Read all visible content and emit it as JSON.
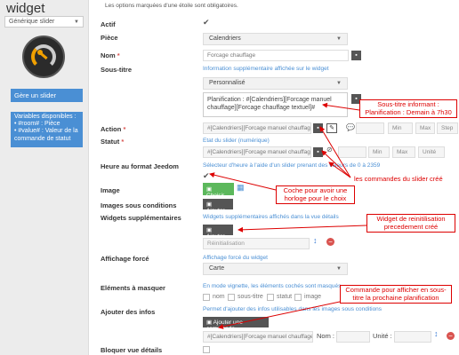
{
  "window": {
    "title": "widget"
  },
  "sidebar": {
    "type_select": "Générique slider",
    "manage_button": "Gère un slider",
    "variables_title": "Variables disponibles :",
    "variables": [
      "#room# : Pièce",
      "#value# : Valeur de la commande de statut"
    ]
  },
  "form": {
    "required_note": "Les options marquées d'une étoile sont obligatoires.",
    "actif": {
      "label": "Actif"
    },
    "piece": {
      "label": "Pièce",
      "value": "Calendriers"
    },
    "nom": {
      "label": "Nom",
      "value": "Forcage chauffage"
    },
    "sous_titre": {
      "label": "Sous-titre",
      "hint": "Information supplémentaire affichée sur le widget",
      "select": "Personnalisé",
      "text": "Planification : #[Calendriers][Forcage manuel chauffage][Forcage chauffage textuel]#"
    },
    "action": {
      "label": "Action",
      "value": "#[Calendriers][Forcage manuel chauffage][",
      "min": "Min",
      "max": "Max",
      "step": "Step"
    },
    "statut": {
      "label": "Statut",
      "hint": "Etat du slider (numérique)",
      "value": "#[Calendriers][Forcage manuel chauffage][",
      "min": "Min",
      "max": "Max",
      "unite": "Unité"
    },
    "heure": {
      "label": "Heure au format Jeedom",
      "hint": "Sélecteur d'heure à l'aide d'un slider prenant des valeurs de 0 à 2359"
    },
    "image": {
      "label": "Image",
      "button": "Choisir"
    },
    "images_conditions": {
      "label": "Images sous conditions",
      "button": "Ajouter"
    },
    "widgets_supp": {
      "label": "Widgets supplémentaires",
      "hint": "Widgets supplémentaires affichés dans la vue détails",
      "button": "Ajouter",
      "item": "Réinitialisation"
    },
    "affichage_force": {
      "label": "Affichage forcé",
      "hint": "Affichage forcé du widget",
      "value": "Carte"
    },
    "elements_masquer": {
      "label": "Eléments à masquer",
      "hint": "En mode vignette, les éléments cochés sont masqués",
      "options": [
        "nom",
        "sous-titre",
        "statut",
        "image"
      ]
    },
    "ajouter_infos": {
      "label": "Ajouter des infos",
      "hint": "Permet d'ajouter des infos utilisables dans les images sous conditions",
      "button": "Ajouter une commande",
      "value": "#[Calendriers][Forcage manuel chauffage][F",
      "nom_label": "Nom :",
      "unite_label": "Unité :"
    },
    "bloquer": {
      "label": "Bloquer vue détails"
    }
  },
  "annotations": [
    "Sous-titre informant : Planification : Demain à 7h30",
    "les commandes du slider créé",
    "Coche pour avoir une horloge pour le choix",
    "Widget de reinitilisation precedement créé",
    "Commande pour afficher en sous-titre la prochaine planification"
  ],
  "colors": {
    "accent": "#4a8fd4",
    "annotation": "#dd0000",
    "green": "#5cb85c",
    "danger": "#d9534f"
  }
}
